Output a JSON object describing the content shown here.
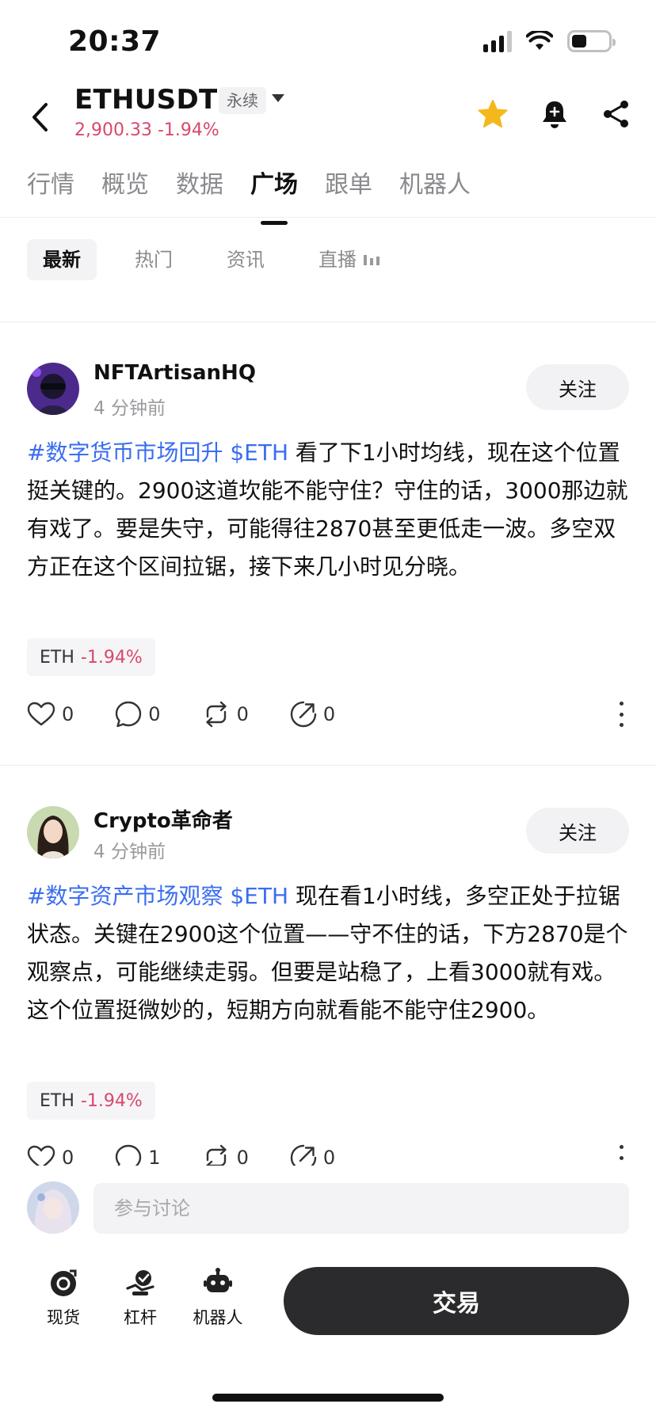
{
  "status_bar": {
    "time": "20:37",
    "battery_level": 0.4
  },
  "header": {
    "pair": "ETHUSDT",
    "contract_type": "永续",
    "price_line": "2,900.33 -1.94%"
  },
  "main_tabs": [
    {
      "label": "行情",
      "active": false
    },
    {
      "label": "概览",
      "active": false
    },
    {
      "label": "数据",
      "active": false
    },
    {
      "label": "广场",
      "active": true
    },
    {
      "label": "跟单",
      "active": false
    },
    {
      "label": "机器人",
      "active": false
    }
  ],
  "sub_tabs": [
    {
      "label": "最新",
      "active": true
    },
    {
      "label": "热门",
      "active": false
    },
    {
      "label": "资讯",
      "active": false
    },
    {
      "label": "直播",
      "active": false,
      "icon": "live-bars-icon"
    }
  ],
  "posts": [
    {
      "username": "NFTArtisanHQ",
      "time": "4 分钟前",
      "follow_label": "关注",
      "tag": "#数字货币市场回升 $ETH",
      "text": " 看了下1小时均线，现在这个位置挺关键的。2900这道坎能不能守住？守住的话，3000那边就有戏了。要是失守，可能得往2870甚至更低走一波。多空双方正在这个区间拉锯，接下来几小时见分晓。",
      "coin": {
        "symbol": "ETH",
        "change": "-1.94%"
      },
      "likes": "0",
      "comments": "0",
      "reposts": "0",
      "shares": "0"
    },
    {
      "username": "Crypto革命者",
      "time": "4 分钟前",
      "follow_label": "关注",
      "tag": "#数字资产市场观察 $ETH",
      "text": " 现在看1小时线，多空正处于拉锯状态。关键在2900这个位置——守不住的话，下方2870是个观察点，可能继续走弱。但要是站稳了，上看3000就有戏。这个位置挺微妙的，短期方向就看能不能守住2900。",
      "coin": {
        "symbol": "ETH",
        "change": "-1.94%"
      },
      "likes": "0",
      "comments": "1",
      "reposts": "0",
      "shares": "0"
    }
  ],
  "comment_bar": {
    "placeholder": "参与讨论"
  },
  "bottom_nav": {
    "items": [
      {
        "label": "现货",
        "icon": "spot-coin-icon"
      },
      {
        "label": "杠杆",
        "icon": "margin-icon"
      },
      {
        "label": "机器人",
        "icon": "robot-icon"
      }
    ],
    "trade_label": "交易"
  },
  "colors": {
    "negative": "#d9486b",
    "hashtag": "#3a6df0",
    "star": "#f5b81c",
    "trade_button": "#2b2b2d"
  }
}
